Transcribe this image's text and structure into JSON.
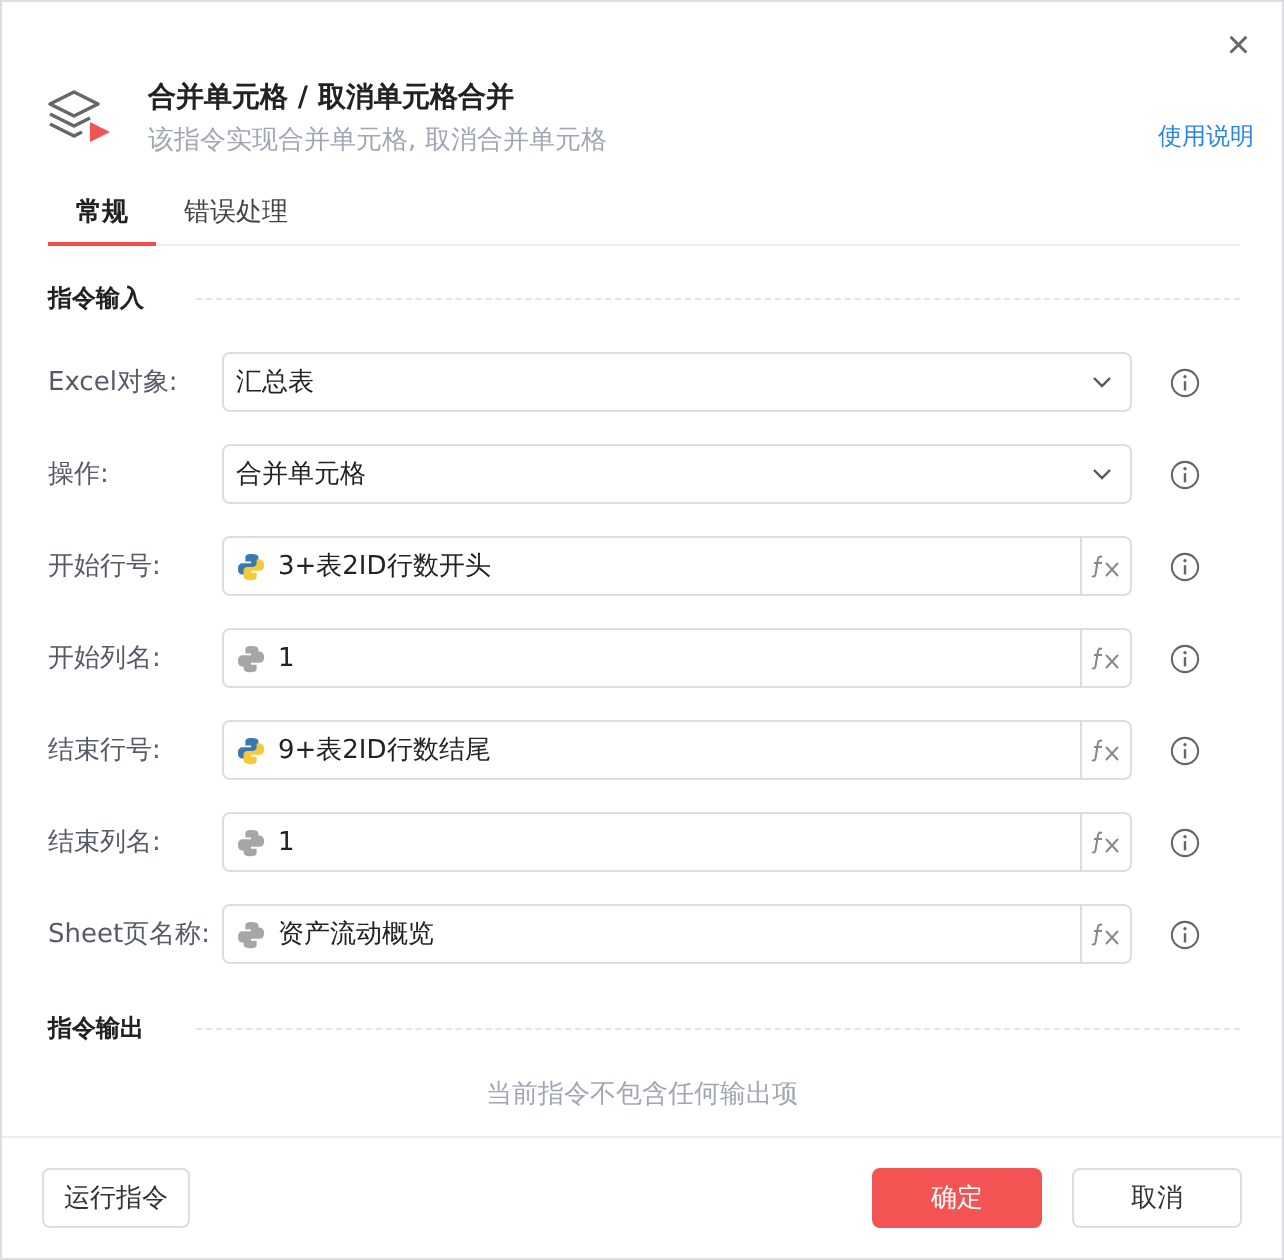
{
  "header": {
    "title": "合并单元格 / 取消单元格合并",
    "subtitle": "该指令实现合并单元格, 取消合并单元格",
    "help_link": "使用说明",
    "close": "×"
  },
  "tabs": [
    {
      "label": "常规",
      "selected": true
    },
    {
      "label": "错误处理",
      "selected": false
    }
  ],
  "input_section": {
    "title": "指令输入",
    "fields": [
      {
        "label": "Excel对象:",
        "kind": "select",
        "value": "汇总表"
      },
      {
        "label": "操作:",
        "kind": "select",
        "value": "合并单元格"
      },
      {
        "label": "开始行号:",
        "kind": "expression",
        "python": true,
        "value": "3+表2ID行数开头"
      },
      {
        "label": "开始列名:",
        "kind": "expression",
        "python": false,
        "value": "1"
      },
      {
        "label": "结束行号:",
        "kind": "expression",
        "python": true,
        "value": "9+表2ID行数结尾"
      },
      {
        "label": "结束列名:",
        "kind": "expression",
        "python": false,
        "value": "1"
      },
      {
        "label": "Sheet页名称:",
        "kind": "expression",
        "python": false,
        "value": "资产流动概览"
      }
    ]
  },
  "output_section": {
    "title": "指令输出",
    "empty_text": "当前指令不包含任何输出项"
  },
  "footer": {
    "run_button": "运行指令",
    "ok_button": "确定",
    "cancel_button": "取消"
  }
}
